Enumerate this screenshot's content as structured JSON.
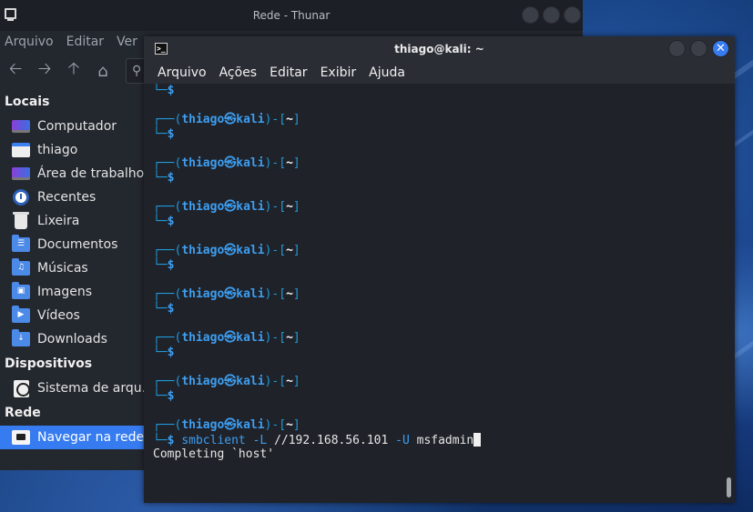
{
  "thunar": {
    "title": "Rede - Thunar",
    "menu": [
      "Arquivo",
      "Editar",
      "Ver"
    ],
    "sidebar": {
      "sections": [
        {
          "header": "Locais",
          "items": [
            {
              "label": "Computador",
              "icon": "computer-icon"
            },
            {
              "label": "thiago",
              "icon": "home-folder-icon"
            },
            {
              "label": "Área de trabalho",
              "icon": "desktop-icon"
            },
            {
              "label": "Recentes",
              "icon": "recent-icon"
            },
            {
              "label": "Lixeira",
              "icon": "trash-icon"
            },
            {
              "label": "Documentos",
              "icon": "documents-folder-icon"
            },
            {
              "label": "Músicas",
              "icon": "music-folder-icon"
            },
            {
              "label": "Imagens",
              "icon": "pictures-folder-icon"
            },
            {
              "label": "Vídeos",
              "icon": "videos-folder-icon"
            },
            {
              "label": "Downloads",
              "icon": "downloads-folder-icon"
            }
          ]
        },
        {
          "header": "Dispositivos",
          "items": [
            {
              "label": "Sistema de arqu…",
              "icon": "drive-icon"
            }
          ]
        },
        {
          "header": "Rede",
          "items": [
            {
              "label": "Navegar na rede",
              "icon": "network-icon",
              "selected": true
            }
          ]
        }
      ]
    }
  },
  "terminal": {
    "title": "thiago@kali: ~",
    "menu": [
      "Arquivo",
      "Ações",
      "Editar",
      "Exibir",
      "Ajuda"
    ],
    "prompt": {
      "open": "┌──(",
      "user": "thiago㉿kali",
      "mid": ")-[",
      "dir": "~",
      "close": "]",
      "arrow": "└─",
      "symbol": "$"
    },
    "empty_prompt_count": 7,
    "command": {
      "name": "smbclient",
      "flag1": "-L",
      "target": "//192.168.56.101",
      "flag2": "-U",
      "user": "msfadmin"
    },
    "output": "Completing `host'"
  },
  "colors": {
    "accent": "#367bf0",
    "prompt_blue": "#3e9ef0",
    "terminal_bg": "#1f2229"
  }
}
